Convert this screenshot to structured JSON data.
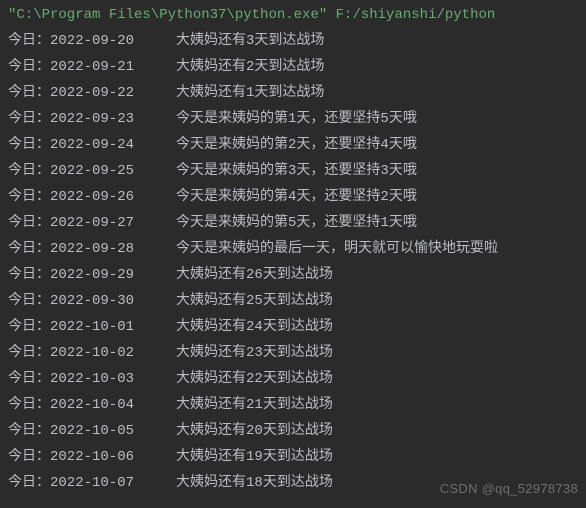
{
  "cmdline": "\"C:\\Program Files\\Python37\\python.exe\" F:/shiyanshi/python",
  "row_prefix": "今日：",
  "rows": [
    {
      "date": "2022-09-20",
      "msg": "大姨妈还有3天到达战场"
    },
    {
      "date": "2022-09-21",
      "msg": "大姨妈还有2天到达战场"
    },
    {
      "date": "2022-09-22",
      "msg": "大姨妈还有1天到达战场"
    },
    {
      "date": "2022-09-23",
      "msg": "今天是来姨妈的第1天，还要坚持5天哦"
    },
    {
      "date": "2022-09-24",
      "msg": "今天是来姨妈的第2天，还要坚持4天哦"
    },
    {
      "date": "2022-09-25",
      "msg": "今天是来姨妈的第3天，还要坚持3天哦"
    },
    {
      "date": "2022-09-26",
      "msg": "今天是来姨妈的第4天，还要坚持2天哦"
    },
    {
      "date": "2022-09-27",
      "msg": "今天是来姨妈的第5天，还要坚持1天哦"
    },
    {
      "date": "2022-09-28",
      "msg": "今天是来姨妈的最后一天，明天就可以愉快地玩耍啦"
    },
    {
      "date": "2022-09-29",
      "msg": "大姨妈还有26天到达战场"
    },
    {
      "date": "2022-09-30",
      "msg": "大姨妈还有25天到达战场"
    },
    {
      "date": "2022-10-01",
      "msg": "大姨妈还有24天到达战场"
    },
    {
      "date": "2022-10-02",
      "msg": "大姨妈还有23天到达战场"
    },
    {
      "date": "2022-10-03",
      "msg": "大姨妈还有22天到达战场"
    },
    {
      "date": "2022-10-04",
      "msg": "大姨妈还有21天到达战场"
    },
    {
      "date": "2022-10-05",
      "msg": "大姨妈还有20天到达战场"
    },
    {
      "date": "2022-10-06",
      "msg": "大姨妈还有19天到达战场"
    },
    {
      "date": "2022-10-07",
      "msg": "大姨妈还有18天到达战场"
    }
  ],
  "watermark": "CSDN @qq_52978738"
}
